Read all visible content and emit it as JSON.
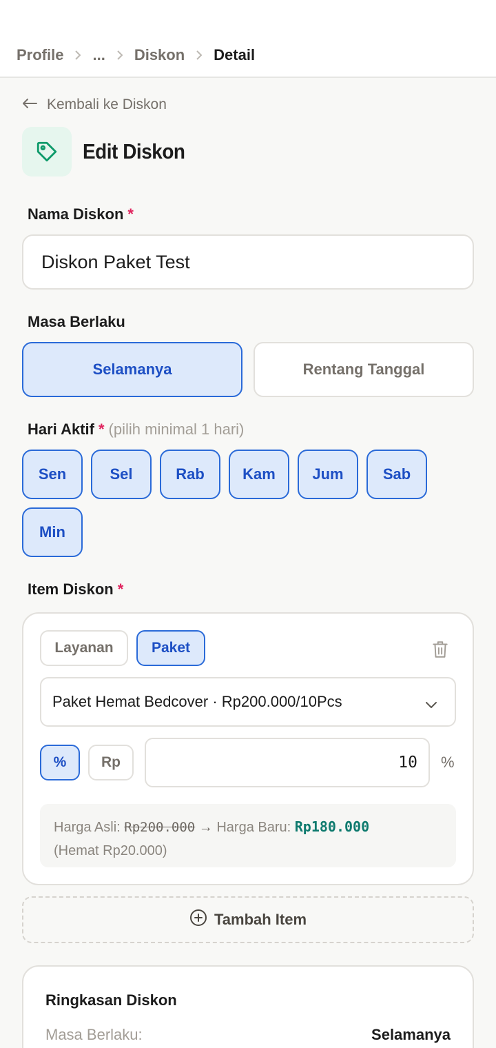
{
  "breadcrumb": {
    "items": [
      "Profile",
      "...",
      "Diskon"
    ],
    "current": "Detail"
  },
  "back_link": "Kembali ke Diskon",
  "page_title": "Edit Diskon",
  "icon_accent": "#0e9a6a",
  "name_field": {
    "label": "Nama Diskon",
    "required_mark": "*",
    "value": "Diskon Paket Test"
  },
  "validity": {
    "label": "Masa Berlaku",
    "options": [
      "Selamanya",
      "Rentang Tanggal"
    ],
    "selected": "Selamanya"
  },
  "active_days": {
    "label": "Hari Aktif",
    "required_mark": "*",
    "hint": "(pilih minimal 1 hari)",
    "days": [
      "Sen",
      "Sel",
      "Rab",
      "Kam",
      "Jum",
      "Sab",
      "Min"
    ],
    "selected": [
      "Sen",
      "Sel",
      "Rab",
      "Kam",
      "Jum",
      "Sab",
      "Min"
    ]
  },
  "items": {
    "label": "Item Diskon",
    "required_mark": "*",
    "type_options": [
      "Layanan",
      "Paket"
    ],
    "type_selected": "Paket",
    "selected_item": "Paket Hemat Bedcover · Rp200.000/10Pcs",
    "unit_options": [
      "%",
      "Rp"
    ],
    "unit_selected": "%",
    "amount": "10",
    "amount_unit": "%",
    "price": {
      "original_label": "Harga Asli:",
      "original": "Rp200.000",
      "arrow": "→",
      "new_label": "Harga Baru:",
      "new": "Rp180.000",
      "savings": "(Hemat Rp20.000)"
    },
    "add_label": "Tambah Item"
  },
  "summary": {
    "title": "Ringkasan Diskon",
    "rows": [
      {
        "key": "Masa Berlaku:",
        "value": "Selamanya"
      }
    ]
  },
  "colors": {
    "accent_blue": "#2a6ad8",
    "selected_bg": "#dde9fb",
    "required": "#e0245e",
    "new_price": "#0e7a6e"
  }
}
